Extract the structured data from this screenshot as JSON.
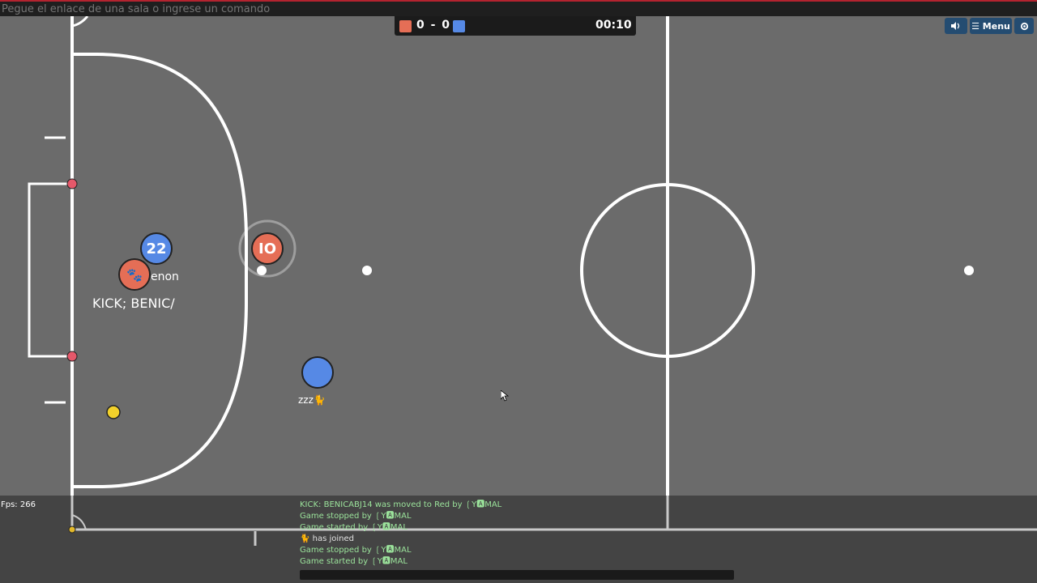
{
  "top_input": {
    "placeholder": "Pegue el enlace de una sala o ingrese un comando"
  },
  "scoreboard": {
    "red_score": "0",
    "separator": "-",
    "blue_score": "0",
    "timer": "00:10"
  },
  "controls": {
    "menu_label": "☰ Menu",
    "sound_icon": "speaker-icon",
    "settings_icon": "gear-icon"
  },
  "colors": {
    "red": "#e56e56",
    "blue": "#5689e5",
    "ball": "#ffffff",
    "field": "#6b6b6b",
    "lines": "#ffffff"
  },
  "players": [
    {
      "id": "p22",
      "team": "blue",
      "avatar": "22",
      "label_fragment": "enon"
    },
    {
      "id": "pkick",
      "team": "red",
      "avatar": "🐾",
      "label": "KICK; BENIC/"
    },
    {
      "id": "p10",
      "team": "red",
      "avatar": "IO"
    },
    {
      "id": "pblue2",
      "team": "blue",
      "avatar": "",
      "label": "zzz🐈"
    }
  ],
  "hud": {
    "fps": "Fps: 266"
  },
  "chat": {
    "lines": [
      {
        "text": "KICK: BENICABJ14 was moved to Red by ❲Y🅰MAL",
        "color": "green"
      },
      {
        "text": "Game stopped by ❲Y🅰MAL",
        "color": "green"
      },
      {
        "text": "Game started by ❲Y🅰MAL",
        "color": "green"
      },
      {
        "text": "🐈 has joined",
        "color": "white"
      },
      {
        "text": "Game stopped by ❲Y🅰MAL",
        "color": "green"
      },
      {
        "text": "Game started by ❲Y🅰MAL",
        "color": "green"
      }
    ]
  }
}
